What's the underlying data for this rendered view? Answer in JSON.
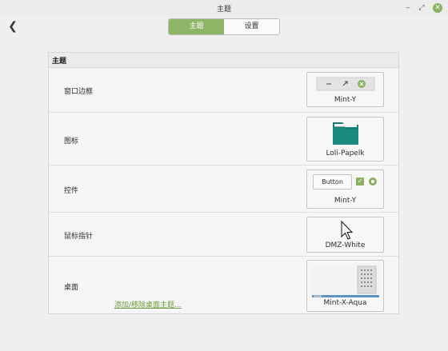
{
  "window": {
    "title": "主题"
  },
  "tabs": [
    "主题",
    "设置"
  ],
  "section": {
    "title": "主题"
  },
  "rows": [
    {
      "label": "窗口边框",
      "theme": "Mint-Y"
    },
    {
      "label": "图标",
      "theme": "Loli-Papelk"
    },
    {
      "label": "控件",
      "theme": "Mint-Y",
      "preview_button": "Button"
    },
    {
      "label": "鼠标指针",
      "theme": "DMZ-White"
    },
    {
      "label": "桌面",
      "theme": "Mint-X-Aqua"
    }
  ],
  "add_remove_link": "添加/移除桌面主题...",
  "icons": {
    "back": "back-arrow-icon",
    "minimize": "minimize-icon",
    "restore": "restore-icon",
    "close": "close-icon"
  },
  "colors": {
    "accent": "#8eb466",
    "folder_teal": "#1b8b81",
    "link": "#6a9a3a"
  }
}
